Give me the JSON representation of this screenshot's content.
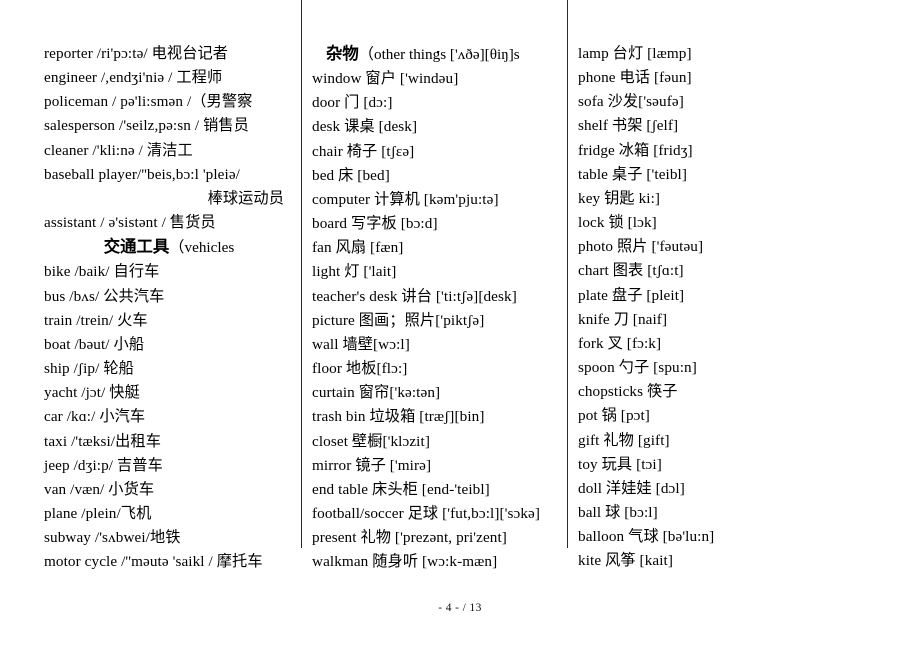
{
  "document": {
    "footer": "- 4 -  / 13"
  },
  "columns": {
    "left": {
      "entries": [
        {
          "text": "reporter /ri'pɔ:tə/  电视台记者"
        },
        {
          "text": "engineer /,endʒi'niə /  工程师"
        },
        {
          "text": "policeman / pə'li:smən /（男警察"
        },
        {
          "text": "salesperson /'seilz,pə:sn /  销售员"
        },
        {
          "text": "cleaner /'kli:nə /  清洁工"
        },
        {
          "text": "baseball player/''beis,bɔ:l 'pleiə/"
        },
        {
          "text": "棒球运动员",
          "align": "right"
        },
        {
          "text": "assistant / ə'sistənt /  售货员"
        }
      ],
      "heading": {
        "cn": "交通工具",
        "en": "（vehicles"
      },
      "entries2": [
        {
          "text": "bike /baik/  自行车"
        },
        {
          "text": "bus /bʌs/  公共汽车"
        },
        {
          "text": "train /trein/  火车"
        },
        {
          "text": "boat /bəut/  小船"
        },
        {
          "text": "ship /ʃip/  轮船"
        },
        {
          "text": "yacht /jɔt/  快艇"
        },
        {
          "text": "car /kɑ:/  小汽车"
        },
        {
          "text": "taxi /'tæksi/出租车"
        },
        {
          "text": "jeep /dʒi:p/  吉普车"
        },
        {
          "text": "van /væn/  小货车"
        },
        {
          "text": "plane /plein/飞机"
        },
        {
          "text": "subway /'sʌbwei/地铁"
        },
        {
          "text": "motor cycle /''məutə 'saikl /  摩托车"
        }
      ]
    },
    "middle": {
      "heading": {
        "cn": "杂物",
        "en": "（other things ['ʌðə][θiŋ]s"
      },
      "entries": [
        {
          "text": "window 窗户  ['windəu]"
        },
        {
          "text": "door 门  [dɔ:]"
        },
        {
          "text": "desk 课桌  [desk]"
        },
        {
          "text": "chair 椅子  [tʃɛə]"
        },
        {
          "text": "bed 床  [bed]"
        },
        {
          "text": "computer 计算机  [kəm'pju:tə]"
        },
        {
          "text": "board 写字板  [bɔ:d]"
        },
        {
          "text": "fan 风扇  [fæn]"
        },
        {
          "text": "light 灯  ['lait]"
        },
        {
          "text": "teacher's desk 讲台  ['ti:tʃə][desk]"
        },
        {
          "text": "picture 图画；照片['piktʃə]"
        },
        {
          "text": "wall 墙壁[wɔ:l]"
        },
        {
          "text": "floor 地板[flɔ:]"
        },
        {
          "text": "curtain 窗帘['kə:tən]"
        },
        {
          "text": "trash bin 垃圾箱  [træʃ][bin]"
        },
        {
          "text": "closet 壁橱['klɔzit]"
        },
        {
          "text": "mirror 镜子  ['mirə]"
        },
        {
          "text": "end table 床头柜  [end-'teibl]"
        },
        {
          "text": "football/soccer 足球  ['fut,bɔ:l]['sɔkə]"
        },
        {
          "text": "present 礼物  ['prezənt, pri'zent]"
        },
        {
          "text": "walkman 随身听  [wɔ:k-mæn]"
        }
      ]
    },
    "right": {
      "entries": [
        {
          "text": "lamp 台灯  [læmp]"
        },
        {
          "text": "phone 电话  [fəun]"
        },
        {
          "text": "sofa 沙发['səufə]"
        },
        {
          "text": "shelf 书架  [ʃelf]"
        },
        {
          "text": "fridge 冰箱  [fridʒ]"
        },
        {
          "text": "table 桌子  ['teibl]"
        },
        {
          "text": "key 钥匙 ki:]"
        },
        {
          "text": "lock 锁  [lɔk]"
        },
        {
          "text": "photo 照片  ['fəutəu]"
        },
        {
          "text": "chart 图表  [tʃɑ:t]"
        },
        {
          "text": "plate 盘子  [pleit]"
        },
        {
          "text": "knife 刀  [naif]"
        },
        {
          "text": "fork 叉  [fɔ:k]"
        },
        {
          "text": "spoon 勺子  [spu:n]"
        },
        {
          "text": "chopsticks 筷子"
        },
        {
          "text": "pot 锅  [pɔt]"
        },
        {
          "text": "gift 礼物  [gift]"
        },
        {
          "text": "toy 玩具  [tɔi]"
        },
        {
          "text": "doll 洋娃娃  [dɔl]"
        },
        {
          "text": "ball 球  [bɔ:l]"
        },
        {
          "text": "balloon 气球  [bə'lu:n]"
        },
        {
          "text": "kite 风筝  [kait]"
        }
      ]
    }
  }
}
